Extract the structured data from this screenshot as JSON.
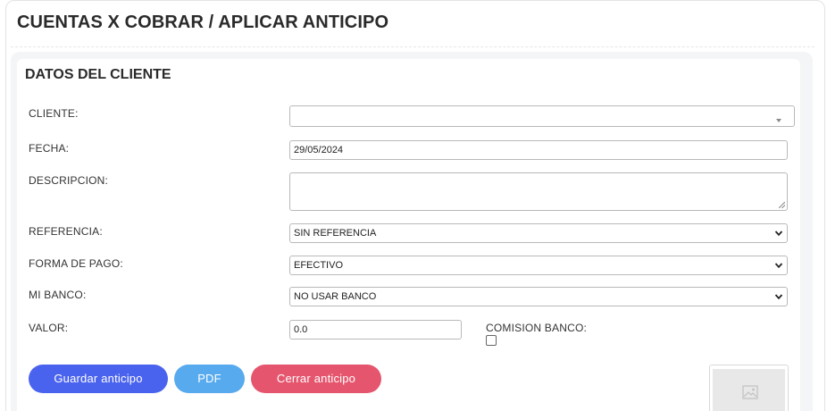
{
  "page_title": "CUENTAS X COBRAR / APLICAR ANTICIPO",
  "section_title": "DATOS DEL CLIENTE",
  "form": {
    "cliente": {
      "label": "CLIENTE:",
      "value": ""
    },
    "fecha": {
      "label": "FECHA:",
      "value": "29/05/2024"
    },
    "descripcion": {
      "label": "DESCRIPCION:",
      "value": ""
    },
    "referencia": {
      "label": "REFERENCIA:",
      "value": "SIN REFERENCIA"
    },
    "forma_pago": {
      "label": "FORMA DE PAGO:",
      "value": "EFECTIVO"
    },
    "mi_banco": {
      "label": "MI BANCO:",
      "value": "NO USAR BANCO"
    },
    "valor": {
      "label": "VALOR:",
      "value": "0.0"
    },
    "comision_banco": {
      "label": "COMISION BANCO:",
      "checked": false
    }
  },
  "buttons": {
    "guardar": "Guardar anticipo",
    "pdf": "PDF",
    "cerrar": "Cerrar anticipo"
  },
  "colors": {
    "guardar": "#4a63ee",
    "pdf": "#57aaee",
    "cerrar": "#e5566e"
  },
  "icons": {
    "select_arrow": "chevron-down-icon",
    "image_placeholder": "image-icon"
  }
}
